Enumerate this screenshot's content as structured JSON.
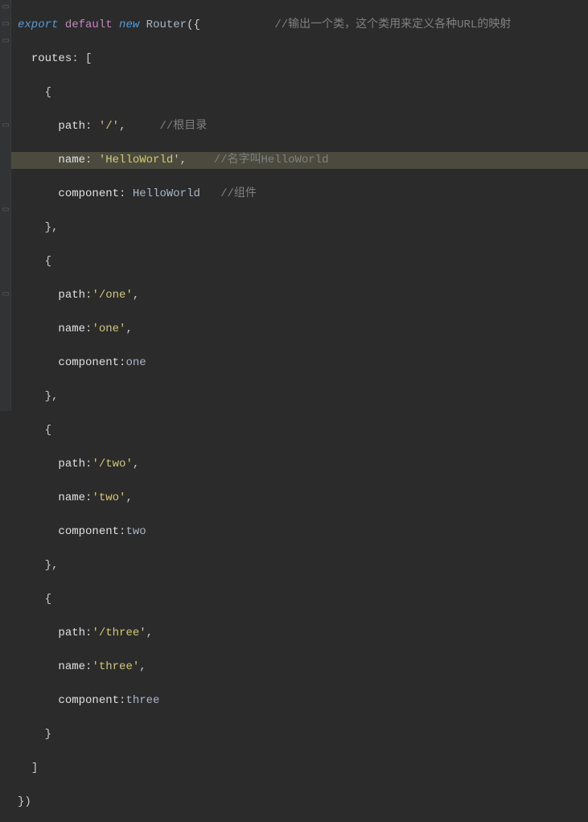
{
  "code": {
    "l1": {
      "export": "export",
      "default": "default",
      "new": "new",
      "cls": "Router",
      "open": "({",
      "comment": "//输出一个类，这个类用来定义各种URL的映射"
    },
    "l2": {
      "prop": "routes",
      "open": ": ["
    },
    "l3": {
      "brace": "{"
    },
    "l4": {
      "prop": "path",
      "val": "'/'",
      "comma": ",",
      "comment": "//根目录"
    },
    "l5": {
      "prop": "name",
      "val": "'HelloWorld'",
      "comma": ",",
      "comment": "//名字叫HelloWorld"
    },
    "l6": {
      "prop": "component",
      "val": "HelloWorld",
      "comment": "//组件"
    },
    "l7": {
      "close": "},"
    },
    "l8": {
      "brace": "{"
    },
    "l9": {
      "prop": "path",
      "val": "'/one'",
      "comma": ","
    },
    "l10": {
      "prop": "name",
      "val": "'one'",
      "comma": ","
    },
    "l11": {
      "prop": "component",
      "val": "one"
    },
    "l12": {
      "close": "},"
    },
    "l13": {
      "brace": "{"
    },
    "l14": {
      "prop": "path",
      "val": "'/two'",
      "comma": ","
    },
    "l15": {
      "prop": "name",
      "val": "'two'",
      "comma": ","
    },
    "l16": {
      "prop": "component",
      "val": "two"
    },
    "l17": {
      "close": "},"
    },
    "l18": {
      "brace": "{"
    },
    "l19": {
      "prop": "path",
      "val": "'/three'",
      "comma": ","
    },
    "l20": {
      "prop": "name",
      "val": "'three'",
      "comma": ","
    },
    "l21": {
      "prop": "component",
      "val": "three"
    },
    "l22": {
      "close": "}"
    },
    "l23": {
      "close": "]"
    },
    "l24": {
      "close": "})"
    }
  }
}
